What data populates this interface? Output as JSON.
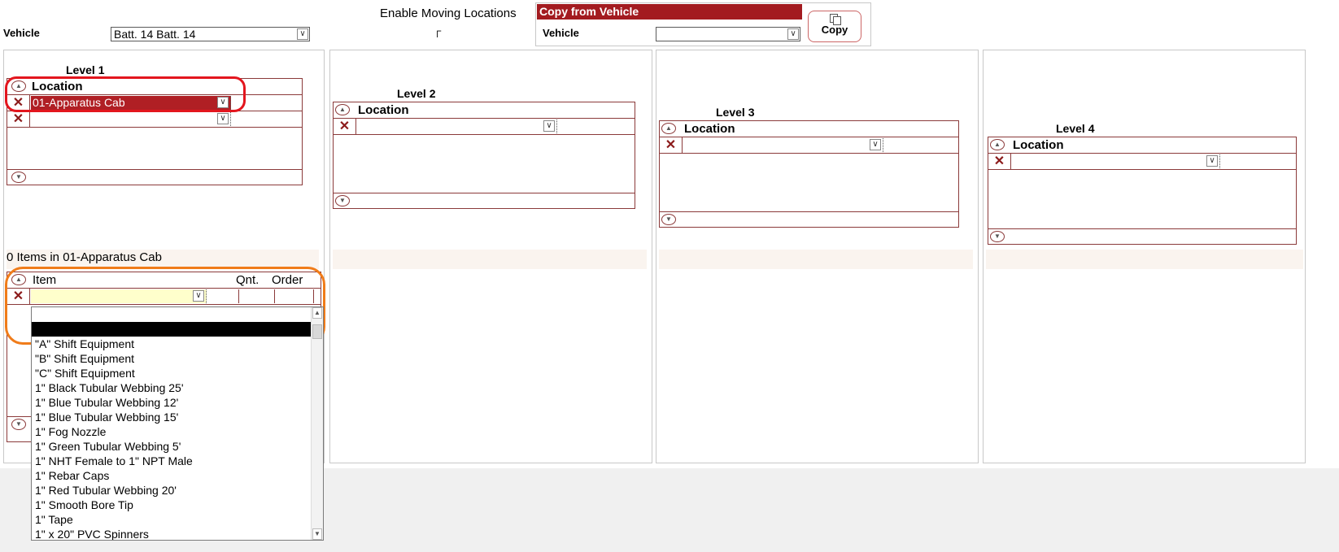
{
  "top": {
    "vehicle_label": "Vehicle",
    "vehicle_value": "Batt. 14 Batt. 14",
    "enable_moving_label": "Enable Moving Locations",
    "checkbox_glyph": "┌",
    "copy_panel_title": "Copy from Vehicle",
    "copy_vehicle_label": "Vehicle",
    "copy_vehicle_value": "",
    "copy_button_label": "Copy"
  },
  "levels": [
    {
      "title": "Level 1",
      "column_header": "Location",
      "rows": [
        "01-Apparatus Cab",
        ""
      ]
    },
    {
      "title": "Level 2",
      "column_header": "Location",
      "rows": [
        ""
      ]
    },
    {
      "title": "Level 3",
      "column_header": "Location",
      "rows": [
        ""
      ]
    },
    {
      "title": "Level 4",
      "column_header": "Location",
      "rows": [
        ""
      ]
    }
  ],
  "items": {
    "summary": "0 Items in 01-Apparatus Cab",
    "headers": {
      "item": "Item",
      "qnt": "Qnt.",
      "order": "Order"
    }
  },
  "dropdown": {
    "options": [
      "",
      "",
      "\"A\" Shift Equipment",
      "\"B\" Shift Equipment",
      "\"C\" Shift Equipment",
      "1\" Black Tubular Webbing 25'",
      "1\" Blue Tubular Webbing 12'",
      "1\" Blue Tubular Webbing 15'",
      "1\" Fog Nozzle",
      "1\" Green Tubular Webbing 5'",
      "1\" NHT Female to 1\" NPT Male",
      "1\" Rebar Caps",
      "1\" Red Tubular Webbing 20'",
      "1\" Smooth Bore Tip",
      "1\" Tape",
      "1\" x 20\" PVC Spinners"
    ],
    "selected_index": 1
  },
  "icons": {
    "delete": "x-icon",
    "scroll_up": "scroll-up-icon",
    "scroll_down": "scroll-down-icon",
    "dropdown": "chevron-down-icon",
    "copy": "copy-icon"
  },
  "colors": {
    "accent_red": "#a31b20",
    "grid_border": "#8b3a3a",
    "highlight_red": "#e3161e",
    "highlight_orange": "#f07c1a",
    "item_input_bg": "#ffffcc"
  }
}
